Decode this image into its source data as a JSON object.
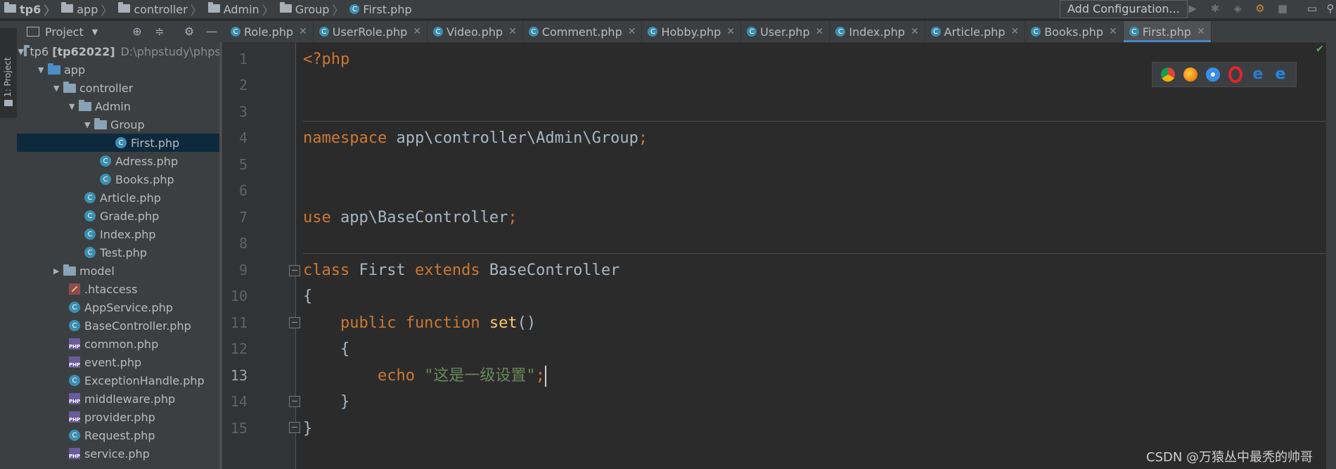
{
  "breadcrumb": {
    "items": [
      "tp6",
      "app",
      "controller",
      "Admin",
      "Group"
    ],
    "file": "First.php"
  },
  "toolbar": {
    "add_configuration": "Add Configuration..."
  },
  "left_strip": {
    "project_tab": "1: Project"
  },
  "project_panel": {
    "title": "Project",
    "root": {
      "name": "tp6",
      "module": "[tp62022]",
      "path": "D:\\phpstudy\\phpst"
    },
    "items": [
      {
        "label": "app"
      },
      {
        "label": "controller"
      },
      {
        "label": "Admin"
      },
      {
        "label": "Group"
      },
      {
        "label": "First.php"
      },
      {
        "label": "Adress.php"
      },
      {
        "label": "Books.php"
      },
      {
        "label": "Article.php"
      },
      {
        "label": "Grade.php"
      },
      {
        "label": "Index.php"
      },
      {
        "label": "Test.php"
      },
      {
        "label": "model"
      },
      {
        "label": ".htaccess"
      },
      {
        "label": "AppService.php"
      },
      {
        "label": "BaseController.php"
      },
      {
        "label": "common.php"
      },
      {
        "label": "event.php"
      },
      {
        "label": "ExceptionHandle.php"
      },
      {
        "label": "middleware.php"
      },
      {
        "label": "provider.php"
      },
      {
        "label": "Request.php"
      },
      {
        "label": "service.php"
      }
    ]
  },
  "tabs": [
    "Role.php",
    "UserRole.php",
    "Video.php",
    "Comment.php",
    "Hobby.php",
    "User.php",
    "Index.php",
    "Article.php",
    "Books.php",
    "First.php"
  ],
  "editor": {
    "line_numbers": [
      "1",
      "2",
      "3",
      "4",
      "5",
      "6",
      "7",
      "8",
      "9",
      "10",
      "11",
      "12",
      "13",
      "14",
      "15"
    ],
    "l1": "<?php",
    "l4_kw": "namespace",
    "l4_tx": " app\\controller\\Admin\\Group",
    "l4_end": ";",
    "l7_kw": "use",
    "l7_tx": " app\\BaseController",
    "l7_end": ";",
    "l9_kw1": "class",
    "l9_tx1": " First ",
    "l9_kw2": "extends",
    "l9_tx2": " BaseController",
    "l10": "{",
    "l11_kw": "    public function ",
    "l11_fn": "set",
    "l11_tx": "()",
    "l12": "    {",
    "l13_kw": "        echo ",
    "l13_str": "\"这是一级设置\"",
    "l13_end": ";",
    "l14": "    }",
    "l15": "}"
  },
  "watermark": "CSDN @万猿丛中最秃的帅哥",
  "colors": {
    "keyword": "#cc7832",
    "text": "#a9b7c6",
    "function": "#ffc66d",
    "string": "#6a8759",
    "selection": "#0d293e"
  }
}
